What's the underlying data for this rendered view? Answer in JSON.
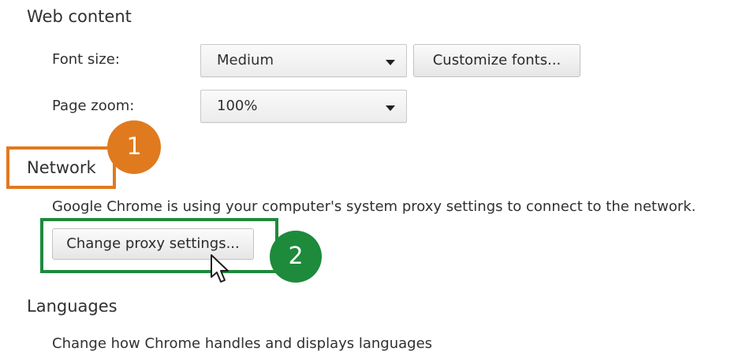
{
  "sections": {
    "web_content": {
      "title": "Web content",
      "font_size": {
        "label": "Font size:",
        "value": "Medium",
        "customize_label": "Customize fonts..."
      },
      "page_zoom": {
        "label": "Page zoom:",
        "value": "100%"
      }
    },
    "network": {
      "title": "Network",
      "description": "Google Chrome is using your computer's system proxy settings to connect to the network.",
      "button_label": "Change proxy settings..."
    },
    "languages": {
      "title": "Languages",
      "description": "Change how Chrome handles and displays languages"
    }
  },
  "annotations": {
    "step1": {
      "number": "1",
      "color": "#e07a1f"
    },
    "step2": {
      "number": "2",
      "color": "#1e8a3c"
    }
  },
  "icons": {
    "cursor": "mouse-pointer-icon",
    "dropdown": "chevron-down-icon"
  }
}
